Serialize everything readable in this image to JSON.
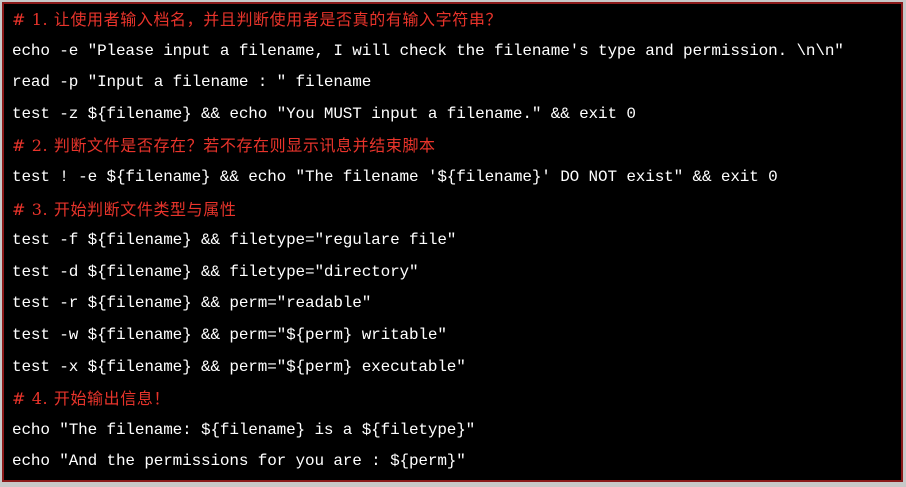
{
  "colors": {
    "background": "#000000",
    "code_text": "#ffffff",
    "comment_text": "#e8342b",
    "frame": "#c8c8c8",
    "border": "#8b1a1a"
  },
  "code_lines": [
    {
      "type": "comment",
      "text": "# 1. 让使用者输入档名，并且判断使用者是否真的有输入字符串？"
    },
    {
      "type": "code",
      "text": "echo -e \"Please input a filename, I will check the filename's type and permission. \\n\\n\""
    },
    {
      "type": "code",
      "text": "read -p \"Input a filename : \" filename"
    },
    {
      "type": "code",
      "text": "test -z ${filename} && echo \"You MUST input a filename.\" && exit 0"
    },
    {
      "type": "comment",
      "text": "# 2. 判断文件是否存在？若不存在则显示讯息并结束脚本"
    },
    {
      "type": "code",
      "text": "test ! -e ${filename} && echo \"The filename '${filename}' DO NOT exist\" && exit 0"
    },
    {
      "type": "comment",
      "text": "# 3. 开始判断文件类型与属性"
    },
    {
      "type": "code",
      "text": "test -f ${filename} && filetype=\"regulare file\""
    },
    {
      "type": "code",
      "text": "test -d ${filename} && filetype=\"directory\""
    },
    {
      "type": "code",
      "text": "test -r ${filename} && perm=\"readable\""
    },
    {
      "type": "code",
      "text": "test -w ${filename} && perm=\"${perm} writable\""
    },
    {
      "type": "code",
      "text": "test -x ${filename} && perm=\"${perm} executable\""
    },
    {
      "type": "comment",
      "text": "# 4. 开始输出信息！"
    },
    {
      "type": "code",
      "text": "echo \"The filename: ${filename} is a ${filetype}\""
    },
    {
      "type": "code",
      "text": "echo \"And the permissions for you are : ${perm}\""
    }
  ]
}
